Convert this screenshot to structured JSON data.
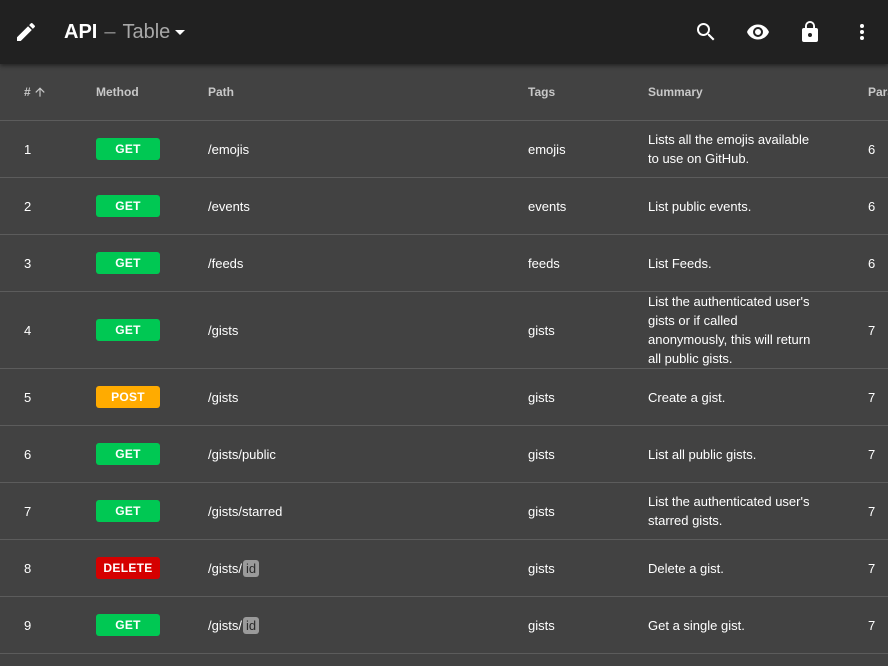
{
  "appbar": {
    "title_api": "API",
    "title_separator": "–",
    "title_view": "Table",
    "icons": [
      "edit-icon",
      "search-icon",
      "eye-icon",
      "lock-icon",
      "more-vert-icon"
    ]
  },
  "table": {
    "columns": {
      "num": "#",
      "method": "Method",
      "path": "Path",
      "tags": "Tags",
      "summary": "Summary",
      "params": "Parameters"
    },
    "method_colors": {
      "GET": "#00c853",
      "POST": "#ffab00",
      "DELETE": "#d50000"
    },
    "rows": [
      {
        "num": "1",
        "method": "GET",
        "path": "/emojis",
        "param": "",
        "tags": "emojis",
        "summary": "Lists all the emojis available to use on GitHub.",
        "params": "6"
      },
      {
        "num": "2",
        "method": "GET",
        "path": "/events",
        "param": "",
        "tags": "events",
        "summary": "List public events.",
        "params": "6"
      },
      {
        "num": "3",
        "method": "GET",
        "path": "/feeds",
        "param": "",
        "tags": "feeds",
        "summary": "List Feeds.",
        "params": "6"
      },
      {
        "num": "4",
        "method": "GET",
        "path": "/gists",
        "param": "",
        "tags": "gists",
        "summary": "List the authenticated user's gists or if called anonymously, this will return all public gists.",
        "params": "7"
      },
      {
        "num": "5",
        "method": "POST",
        "path": "/gists",
        "param": "",
        "tags": "gists",
        "summary": "Create a gist.",
        "params": "7"
      },
      {
        "num": "6",
        "method": "GET",
        "path": "/gists/public",
        "param": "",
        "tags": "gists",
        "summary": "List all public gists.",
        "params": "7"
      },
      {
        "num": "7",
        "method": "GET",
        "path": "/gists/starred",
        "param": "",
        "tags": "gists",
        "summary": "List the authenticated user's starred gists.",
        "params": "7"
      },
      {
        "num": "8",
        "method": "DELETE",
        "path": "/gists/",
        "param": "id",
        "tags": "gists",
        "summary": "Delete a gist.",
        "params": "7"
      },
      {
        "num": "9",
        "method": "GET",
        "path": "/gists/",
        "param": "id",
        "tags": "gists",
        "summary": "Get a single gist.",
        "params": "7"
      }
    ]
  }
}
